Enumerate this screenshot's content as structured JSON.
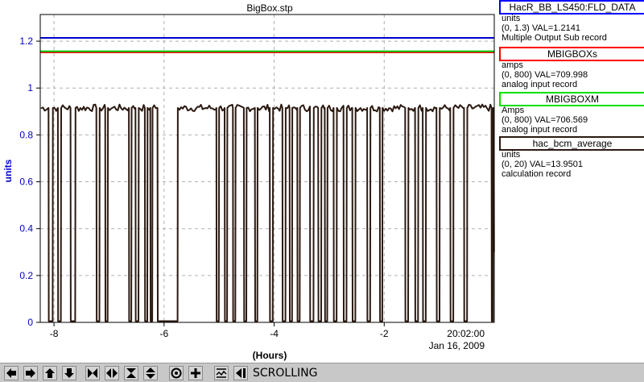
{
  "chart_data": {
    "type": "line",
    "title": "BigBox.stp",
    "ylabel": "units",
    "xlabel": "(Hours)",
    "xlim": [
      -8.25,
      0
    ],
    "ylim": [
      0,
      1.3
    ],
    "yticks": [
      "0",
      "0.2",
      "0.4",
      "0.6",
      "0.8",
      "1",
      "1.2"
    ],
    "yticks_values": [
      0,
      0.2,
      0.4,
      0.6,
      0.8,
      1.0,
      1.2
    ],
    "xticks": [
      "-8",
      "-6",
      "-4",
      "-2"
    ],
    "xticks_values": [
      -8,
      -6,
      -4,
      -2
    ],
    "end_time": "20:02:00",
    "end_date": "Jan 16, 2009",
    "grid": true,
    "series": [
      {
        "name": "HacR_BB_LS450:FLD_DATA",
        "color": "#0000cc",
        "constant": 1.2141
      },
      {
        "name": "MBIGBOXs",
        "color": "#ff0000",
        "constant": 1.152
      },
      {
        "name": "MBIGBOXM",
        "color": "#00cc00",
        "constant": 1.157
      },
      {
        "name": "hac_bcm_average",
        "color": "#2b1a12",
        "baseline": 0.915,
        "dropouts": [
          [
            -8.1,
            -8.02
          ],
          [
            -7.93,
            -7.87
          ],
          [
            -7.7,
            -7.61
          ],
          [
            -7.23,
            -7.17
          ],
          [
            -7.07,
            -7.02
          ],
          [
            -6.64,
            -6.59
          ],
          [
            -6.52,
            -6.46
          ],
          [
            -6.35,
            -6.3
          ],
          [
            -6.25,
            -6.21
          ],
          [
            -6.12,
            -5.75
          ],
          [
            -5.05,
            -5.0
          ],
          [
            -4.9,
            -4.85
          ],
          [
            -4.75,
            -4.7
          ],
          [
            -4.55,
            -4.5
          ],
          [
            -4.35,
            -4.3
          ],
          [
            -4.08,
            -4.02
          ],
          [
            -3.85,
            -3.79
          ],
          [
            -3.72,
            -3.67
          ],
          [
            -3.58,
            -3.53
          ],
          [
            -3.35,
            -3.28
          ],
          [
            -3.2,
            -3.14
          ],
          [
            -3.08,
            -3.03
          ],
          [
            -2.92,
            -2.86
          ],
          [
            -2.74,
            -2.68
          ],
          [
            -2.58,
            -2.52
          ],
          [
            -2.31,
            -2.25
          ],
          [
            -2.08,
            -2.03
          ],
          [
            -1.62,
            -1.56
          ],
          [
            -1.44,
            -1.38
          ],
          [
            -1.3,
            -1.24
          ],
          [
            -1.05,
            -0.99
          ],
          [
            -0.8,
            -0.74
          ],
          [
            -0.55,
            -0.49
          ],
          [
            -0.05,
            -0.02
          ]
        ]
      }
    ]
  },
  "legend": [
    {
      "name": "HacR_BB_LS450:FLD_DATA",
      "color": "#0000ff",
      "units": "units",
      "range": "(0, 1.3) VAL=1.2141",
      "desc": "Multiple Output Sub record"
    },
    {
      "name": "MBIGBOXs",
      "color": "#ff0000",
      "units": "amps",
      "range": "(0, 800) VAL=709.998",
      "desc": "analog input record"
    },
    {
      "name": "MBIGBOXM",
      "color": "#00e000",
      "units": "Amps",
      "range": "(0, 800) VAL=706.569",
      "desc": "analog input record"
    },
    {
      "name": "hac_bcm_average",
      "color": "#2b1a12",
      "units": "units",
      "range": "(0, 20) VAL=13.9501",
      "desc": "calculation record"
    }
  ],
  "toolbar": {
    "status": "SCROLLING",
    "buttons": [
      "arrow-left-icon",
      "arrow-right-icon",
      "arrow-up-icon",
      "arrow-down-icon",
      "zoom-in-horizontal-icon",
      "zoom-out-horizontal-icon",
      "zoom-in-vertical-icon",
      "zoom-out-vertical-icon",
      "target-icon",
      "crosshair-icon",
      "autoscale-icon",
      "play-scroll-icon"
    ]
  }
}
